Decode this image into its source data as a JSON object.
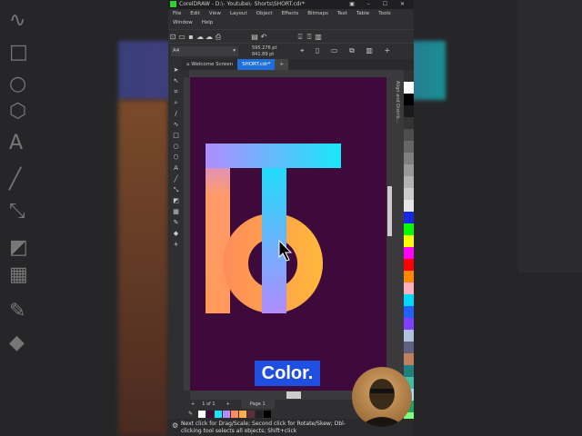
{
  "app": {
    "title": "CorelDRAW - D:\\- Youtube\\- Shorts\\SHORT.cdr*"
  },
  "menu": [
    "File",
    "Edit",
    "View",
    "Layout",
    "Object",
    "Effects",
    "Bitmaps",
    "Text",
    "Table",
    "Tools",
    "Window",
    "Help"
  ],
  "propertybar": {
    "page_size": "A4",
    "width": "595.276 pt",
    "height": "841.89 pt"
  },
  "tabs": [
    "Welcome Screen",
    "SHORT.cdr*"
  ],
  "docker": {
    "label": "Align and Distrib..."
  },
  "page_nav": {
    "counter": "1 of 1",
    "page_tab": "Page 1"
  },
  "status": {
    "text": "Next click for Drag/Scale; Second click for Rotate/Skew; Dbl-clicking tool selects all objects; Shift+click"
  },
  "caption": "Color.",
  "colors": {
    "canvas": "#3d0a3b",
    "accent": "#1f4fe0",
    "swatches": [
      "#ffffff",
      "#3d0a3b",
      "#22e0f0",
      "#b48cff",
      "#ff8c5a",
      "#ffb040",
      "#5a3040",
      "#222222",
      "#000000"
    ]
  }
}
